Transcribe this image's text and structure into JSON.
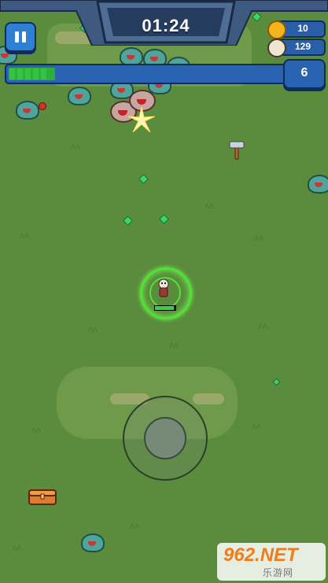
{
  "hud": {
    "timer": "01:24",
    "coins": "10",
    "kills": "129",
    "level": "6",
    "xp_progress": 0.17
  },
  "player": {
    "hp_fraction": 0.92
  },
  "icons": {
    "pause": "pause-icon",
    "coin": "coin-icon",
    "kills": "skull-icon",
    "hammer": "hammer-icon",
    "chest": "chest-icon"
  },
  "watermark": {
    "main": "962.NET",
    "sub": "乐游网"
  },
  "colors": {
    "grass": "#5b8b3d",
    "hud_blue": "#2a63b2",
    "xp_green": "#2fae3b",
    "aura": "#52e03b",
    "coin": "#f3b51c"
  }
}
